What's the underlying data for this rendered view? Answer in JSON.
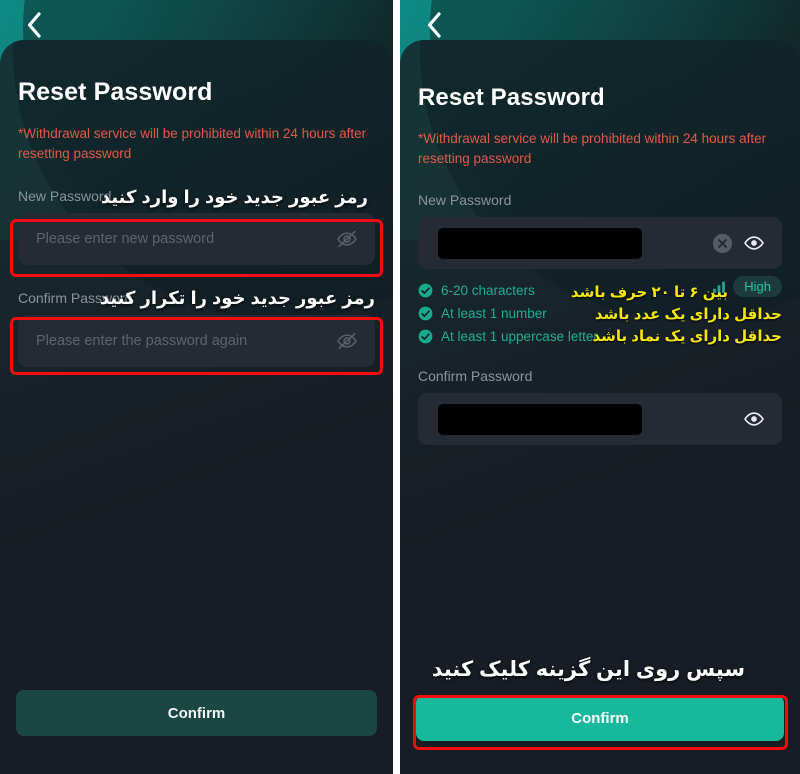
{
  "app": {
    "screen_title": "Reset Password",
    "warning": "*Withdrawal service will be prohibited within 24 hours after resetting password",
    "back_icon": "chevron-left-icon"
  },
  "left_panel": {
    "title": "Reset Password",
    "warning": "*Withdrawal service will be prohibited within 24 hours after resetting password",
    "new_password": {
      "label": "New Password",
      "placeholder": "Please enter new password",
      "value": "",
      "toggle_icon": "eye-off-icon"
    },
    "confirm_password": {
      "label": "Confirm Password",
      "placeholder": "Please enter the password again",
      "value": "",
      "toggle_icon": "eye-off-icon"
    },
    "confirm_button": {
      "label": "Confirm",
      "state": "disabled"
    },
    "annotations": [
      {
        "text": "رمز عبور جدید خود را وارد کنید",
        "color": "#ffffff"
      },
      {
        "text": "رمز عبور جدید خود را تکرار کنید",
        "color": "#ffffff"
      }
    ]
  },
  "right_panel": {
    "title": "Reset Password",
    "warning": "*Withdrawal service will be prohibited within 24 hours after resetting password",
    "new_password": {
      "label": "New Password",
      "value": "••••••••••",
      "clear_icon": "circle-x-icon",
      "toggle_icon": "eye-icon"
    },
    "confirm_password": {
      "label": "Confirm Password",
      "value": "••••••••••",
      "toggle_icon": "eye-icon"
    },
    "rules": [
      {
        "text": "6-20 characters",
        "met": true,
        "icon": "check-circle-icon"
      },
      {
        "text": "At least 1 number",
        "met": true,
        "icon": "check-circle-icon"
      },
      {
        "text": "At least 1 uppercase letter",
        "met": true,
        "icon": "check-circle-icon"
      }
    ],
    "strength": {
      "label": "High",
      "icon": "signal-bars-icon"
    },
    "confirm_button": {
      "label": "Confirm",
      "state": "active"
    },
    "annotations": [
      {
        "text": "بین ۶ تا ۲۰ حرف باشد",
        "color": "#f5e70b"
      },
      {
        "text": "حداقل دارای یک عدد باشد",
        "color": "#f5e70b"
      },
      {
        "text": "حداقل دارای یک نماد باشد",
        "color": "#f5e70b"
      },
      {
        "text": "سپس روی این گزینه کلیک کنید",
        "color": "#ffffff"
      }
    ]
  },
  "colors": {
    "accent": "#17b89a",
    "accent_muted": "#1b4743",
    "warning": "#e05a4a",
    "annotation_box": "#f40d0d",
    "annotation_yellow": "#f5e70b",
    "rule_text": "#1fae93",
    "background": "#181c24",
    "field_background": "#252a34"
  }
}
